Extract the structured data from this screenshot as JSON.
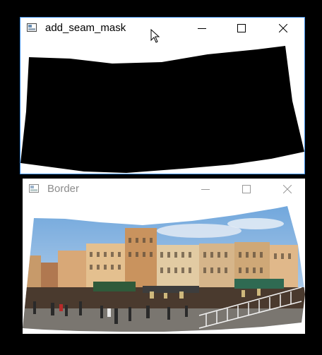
{
  "windows": [
    {
      "title": "add_seam_mask",
      "controls": {
        "minimize": "minimize-icon",
        "maximize": "maximize-icon",
        "close": "close-icon"
      }
    },
    {
      "title": "Border",
      "controls": {
        "minimize": "minimize-icon",
        "maximize": "maximize-icon",
        "close": "close-icon"
      }
    }
  ],
  "colors": {
    "desktop": "#000000",
    "active_border": "#3b8ee6",
    "mask_fill": "#000000",
    "border_line": "#c9453c"
  }
}
